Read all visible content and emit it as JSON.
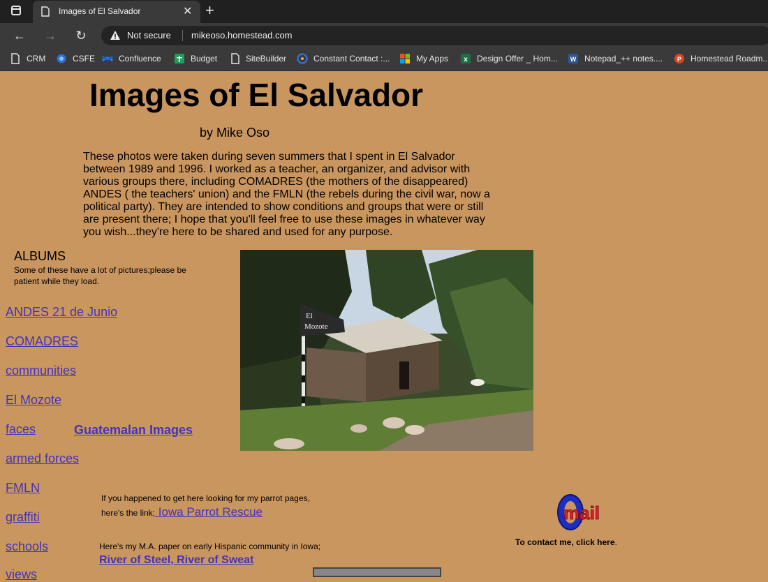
{
  "browser": {
    "tab_title": "Images of El Salvador",
    "security_label": "Not secure",
    "url": "mikeoso.homestead.com",
    "bookmarks": [
      {
        "label": "CRM",
        "icon": "page-icon"
      },
      {
        "label": "CSFE",
        "icon": "globe-icon"
      },
      {
        "label": "Confluence",
        "icon": "confluence-icon"
      },
      {
        "label": "Budget",
        "icon": "sheets-icon"
      },
      {
        "label": "SiteBuilder",
        "icon": "page-icon"
      },
      {
        "label": "Constant Contact :...",
        "icon": "constant-contact-icon"
      },
      {
        "label": "My Apps",
        "icon": "microsoft-icon"
      },
      {
        "label": "Design Offer _ Hom...",
        "icon": "excel-icon"
      },
      {
        "label": "Notepad_++ notes....",
        "icon": "word-icon"
      },
      {
        "label": "Homestead Roadm...",
        "icon": "powerpoint-icon"
      }
    ],
    "colors": {
      "chrome_dark": "#202020",
      "chrome": "#3a3a3a",
      "omnibox": "#232323"
    }
  },
  "page": {
    "title": "Images of El Salvador",
    "byline": "by Mike Oso",
    "intro": "These photos were taken during seven summers that I spent in El Salvador between 1989 and 1996. I worked as a teacher, an organizer, and advisor with various groups there, including COMADRES (the mothers of the disappeared) ANDES ( the teachers' union) and the FMLN (the rebels during the civil war, now a political party).  They are intended to show conditions and groups that were or still are present there; I hope that you'll feel free to use these images in whatever way you wish...they're here to be shared and used for any purpose.",
    "albums_heading": "ALBUMS",
    "albums_note": "Some of these have a lot of pictures;please be patient while they load.",
    "albums": [
      "ANDES 21 de Junio",
      "COMADRES",
      "communities",
      "El Mozote",
      "faces",
      "armed forces",
      "FMLN",
      "graffiti",
      "schools",
      "views"
    ],
    "guatemala_link": "Guatemalan Images",
    "photo": {
      "sign_text_1": "El",
      "sign_text_2": "Mozote"
    },
    "parrot_text": "If you happened to get here looking for my parrot pages, here's the link;",
    "parrot_link": " Iowa Parrot Rescue",
    "paper_text": "Here's my M.A. paper on  early Hispanic community in Iowa; ",
    "paper_link": "River of Steel, River of Sweat",
    "mail_logo_text": "mail",
    "contact_text": "To contact me, click here",
    "contact_suffix": ".",
    "colors": {
      "background": "#c9965f",
      "link": "#4433bb"
    }
  }
}
